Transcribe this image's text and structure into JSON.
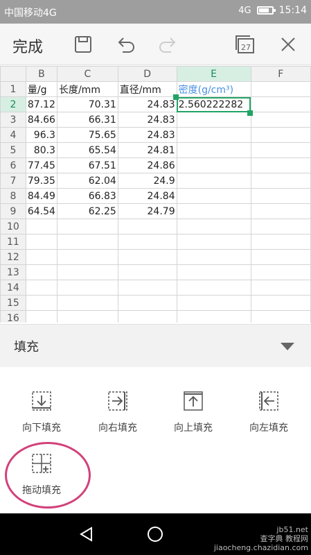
{
  "status": {
    "carrier": "中国移动4G",
    "network": "4G",
    "time": "15:14",
    "battery_level": 0.8
  },
  "toolbar": {
    "done_label": "完成",
    "calendar_day": "27"
  },
  "sheet": {
    "columns": [
      "B",
      "C",
      "D",
      "E",
      "F"
    ],
    "rows": [
      {
        "num": "1",
        "cells": [
          "量/g",
          "长度/mm",
          "直径/mm",
          "密度(g/cm³)",
          ""
        ]
      },
      {
        "num": "2",
        "cells": [
          "87.12",
          "70.31",
          "24.83",
          "2.560222282",
          ""
        ]
      },
      {
        "num": "3",
        "cells": [
          "84.66",
          "66.31",
          "24.83",
          "",
          ""
        ]
      },
      {
        "num": "4",
        "cells": [
          "96.3",
          "75.65",
          "24.83",
          "",
          ""
        ]
      },
      {
        "num": "5",
        "cells": [
          "80.3",
          "65.54",
          "24.81",
          "",
          ""
        ]
      },
      {
        "num": "6",
        "cells": [
          "77.45",
          "67.51",
          "24.86",
          "",
          ""
        ]
      },
      {
        "num": "7",
        "cells": [
          "79.35",
          "62.04",
          "24.9",
          "",
          ""
        ]
      },
      {
        "num": "8",
        "cells": [
          "84.49",
          "66.83",
          "24.84",
          "",
          ""
        ]
      },
      {
        "num": "9",
        "cells": [
          "64.54",
          "62.25",
          "24.79",
          "",
          ""
        ]
      },
      {
        "num": "10",
        "cells": [
          "",
          "",
          "",
          "",
          ""
        ]
      },
      {
        "num": "11",
        "cells": [
          "",
          "",
          "",
          "",
          ""
        ]
      },
      {
        "num": "12",
        "cells": [
          "",
          "",
          "",
          "",
          ""
        ]
      },
      {
        "num": "13",
        "cells": [
          "",
          "",
          "",
          "",
          ""
        ]
      },
      {
        "num": "14",
        "cells": [
          "",
          "",
          "",
          "",
          ""
        ]
      },
      {
        "num": "15",
        "cells": [
          "",
          "",
          "",
          "",
          ""
        ]
      },
      {
        "num": "16",
        "cells": [
          "",
          "",
          "",
          "",
          ""
        ]
      }
    ],
    "active_column": "E",
    "active_row": "2"
  },
  "fill": {
    "title": "填充",
    "options": [
      {
        "label": "向下填充",
        "icon": "fill-down-icon"
      },
      {
        "label": "向右填充",
        "icon": "fill-right-icon"
      },
      {
        "label": "向上填充",
        "icon": "fill-up-icon"
      },
      {
        "label": "向左填充",
        "icon": "fill-left-icon"
      },
      {
        "label": "拖动填充",
        "icon": "drag-fill-icon"
      }
    ]
  },
  "watermark": {
    "line1": "jb51.net",
    "line2": "查字典 教程网",
    "line3": "jiaocheng.chazidian.com"
  },
  "colors": {
    "accent": "#21a366",
    "highlight_circle": "#d2417a",
    "header_blue": "#4a90e2"
  }
}
